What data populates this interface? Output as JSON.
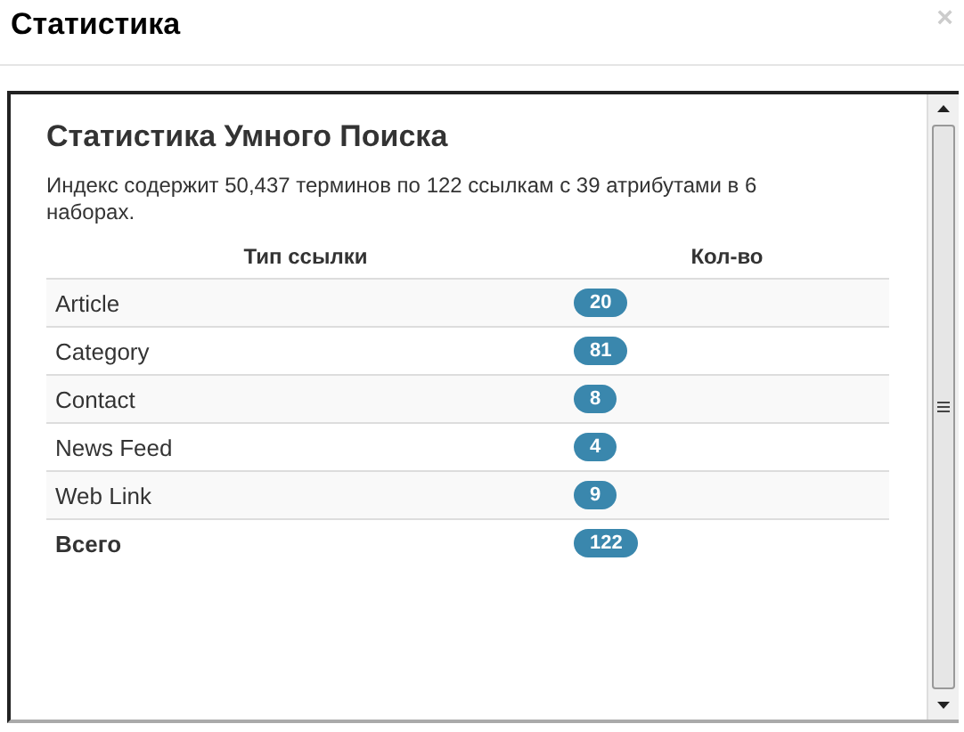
{
  "window": {
    "title": "Статистика",
    "close": "×"
  },
  "content": {
    "heading": "Статистика Умного Поиска",
    "description": "Индекс содержит 50,437 терминов по 122 ссылкам с 39 атрибутами в 6 наборах."
  },
  "table": {
    "columns": [
      "Тип ссылки",
      "Кол-во"
    ],
    "rows": [
      {
        "kind": "item",
        "type": "Article",
        "count": "20"
      },
      {
        "kind": "item",
        "type": "Category",
        "count": "81"
      },
      {
        "kind": "item",
        "type": "Contact",
        "count": "8"
      },
      {
        "kind": "item",
        "type": "News Feed",
        "count": "4"
      },
      {
        "kind": "item",
        "type": "Web Link",
        "count": "9"
      },
      {
        "kind": "total",
        "type": "Всего",
        "count": "122"
      }
    ]
  }
}
